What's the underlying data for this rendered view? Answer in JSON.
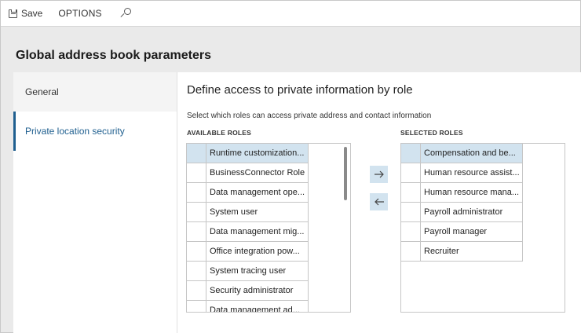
{
  "toolbar": {
    "save_label": "Save",
    "options_label": "OPTIONS",
    "icons": {
      "save": "save-icon",
      "search": "search-icon"
    }
  },
  "page": {
    "title": "Global address book parameters"
  },
  "tabs": [
    {
      "label": "General",
      "active": false
    },
    {
      "label": "Private location security",
      "active": true
    }
  ],
  "panel": {
    "title": "Define access to private information by role",
    "description": "Select which roles can access private address and contact information",
    "available_label": "AVAILABLE ROLES",
    "selected_label": "SELECTED ROLES",
    "available_roles": [
      "Runtime customization...",
      "BusinessConnector Role",
      "Data management ope...",
      "System user",
      "Data management mig...",
      "Office integration pow...",
      "System tracing user",
      "Security administrator",
      "Data management ad..."
    ],
    "selected_roles": [
      "Compensation and be...",
      "Human resource assist...",
      "Human resource mana...",
      "Payroll administrator",
      "Payroll manager",
      "Recruiter"
    ],
    "buttons": {
      "add": "arrow-right-icon",
      "remove": "arrow-left-icon"
    }
  },
  "colors": {
    "accent": "#1f5f8f",
    "selected_row": "#d2e3ef",
    "background": "#eaeaea"
  }
}
